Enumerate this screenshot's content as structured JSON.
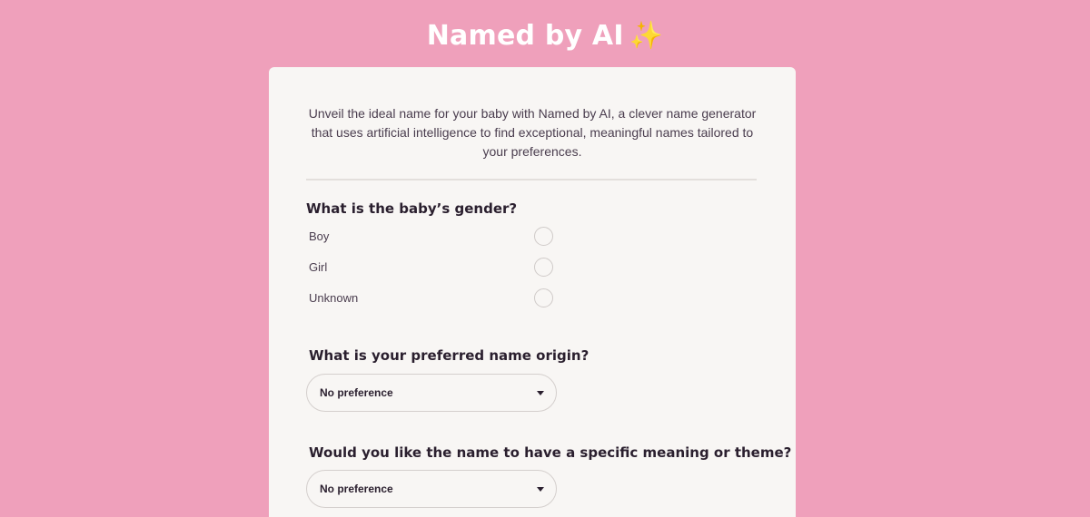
{
  "header": {
    "title": "Named by AI",
    "sparkle": "✨"
  },
  "intro": {
    "text": "Unveil the ideal name for your baby with Named by AI, a clever name generator that uses artificial intelligence to find exceptional, meaningful names tailored to your preferences."
  },
  "gender": {
    "question": "What is the baby’s gender?",
    "options": [
      "Boy",
      "Girl",
      "Unknown"
    ]
  },
  "origin": {
    "question": "What is your preferred name origin?",
    "selected": "No preference"
  },
  "meaning": {
    "question": "Would you like the name to have a specific meaning or theme?",
    "selected": "No preference"
  },
  "colors": {
    "background": "#efa0bb",
    "card": "#f8f6f4",
    "sparkle": "#f6c63b"
  }
}
